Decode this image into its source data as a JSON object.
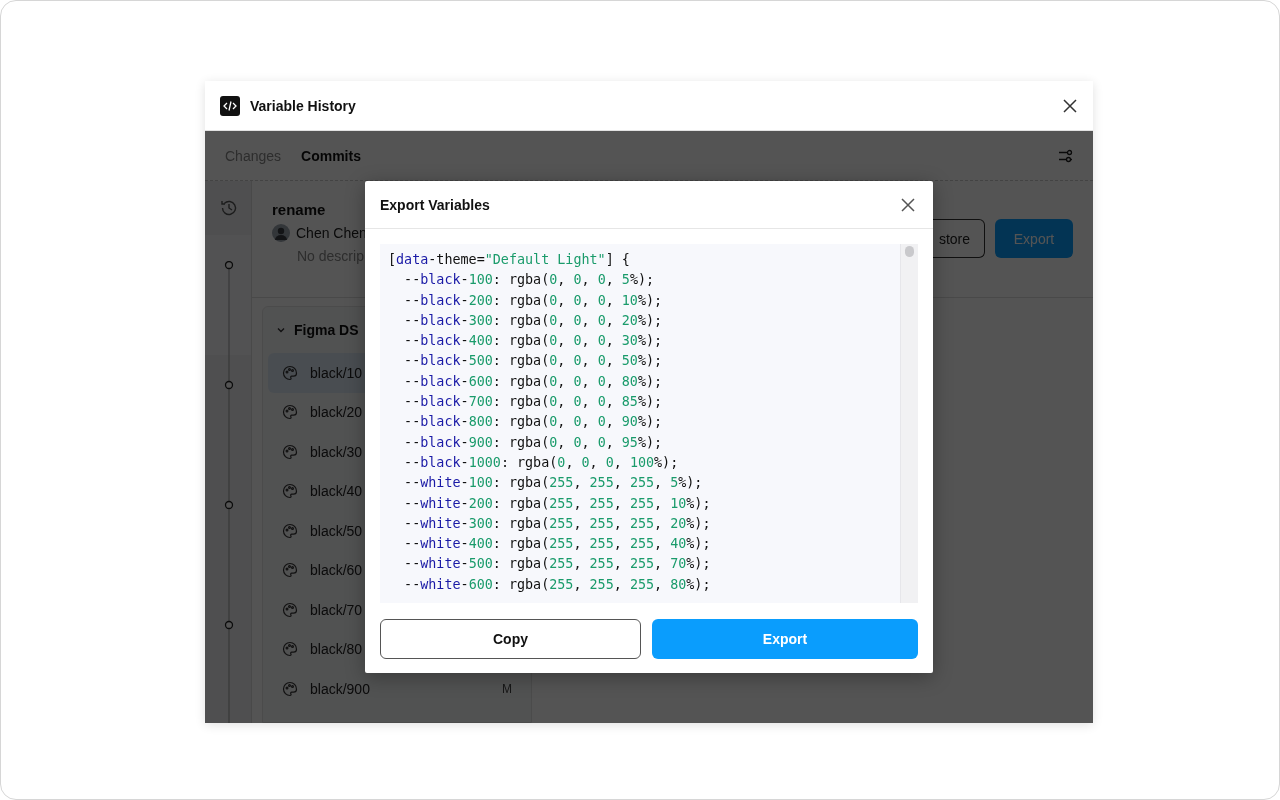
{
  "window": {
    "title": "Variable History"
  },
  "tabs": [
    {
      "label": "Changes",
      "selected": false
    },
    {
      "label": "Commits",
      "selected": true
    }
  ],
  "commit": {
    "title": "rename",
    "author": "Chen Chen",
    "description": "No descrip"
  },
  "actions": [
    {
      "label": "store",
      "kind": "secondary"
    },
    {
      "label": "Export",
      "kind": "primary"
    }
  ],
  "collection": {
    "name": "Figma DS",
    "expanded": true,
    "items": [
      {
        "name": "black/10",
        "selected": true
      },
      {
        "name": "black/20",
        "selected": false
      },
      {
        "name": "black/30",
        "selected": false
      },
      {
        "name": "black/40",
        "selected": false
      },
      {
        "name": "black/50",
        "selected": false
      },
      {
        "name": "black/60",
        "selected": false
      },
      {
        "name": "black/70",
        "selected": false
      },
      {
        "name": "black/80",
        "selected": false
      },
      {
        "name": "black/900",
        "selected": false,
        "badge": "M"
      }
    ]
  },
  "dialog": {
    "title": "Export Variables",
    "code": [
      "[data-theme=\"Default Light\"] {",
      "  --black-100: rgba(0, 0, 0, 5%);",
      "  --black-200: rgba(0, 0, 0, 10%);",
      "  --black-300: rgba(0, 0, 0, 20%);",
      "  --black-400: rgba(0, 0, 0, 30%);",
      "  --black-500: rgba(0, 0, 0, 50%);",
      "  --black-600: rgba(0, 0, 0, 80%);",
      "  --black-700: rgba(0, 0, 0, 85%);",
      "  --black-800: rgba(0, 0, 0, 90%);",
      "  --black-900: rgba(0, 0, 0, 95%);",
      "  --black-1000: rgba(0, 0, 0, 100%);",
      "  --white-100: rgba(255, 255, 255, 5%);",
      "  --white-200: rgba(255, 255, 255, 10%);",
      "  --white-300: rgba(255, 255, 255, 20%);",
      "  --white-400: rgba(255, 255, 255, 40%);",
      "  --white-500: rgba(255, 255, 255, 70%);",
      "  --white-600: rgba(255, 255, 255, 80%);"
    ],
    "buttons": [
      {
        "label": "Copy",
        "kind": "secondary"
      },
      {
        "label": "Export",
        "kind": "primary"
      }
    ]
  }
}
